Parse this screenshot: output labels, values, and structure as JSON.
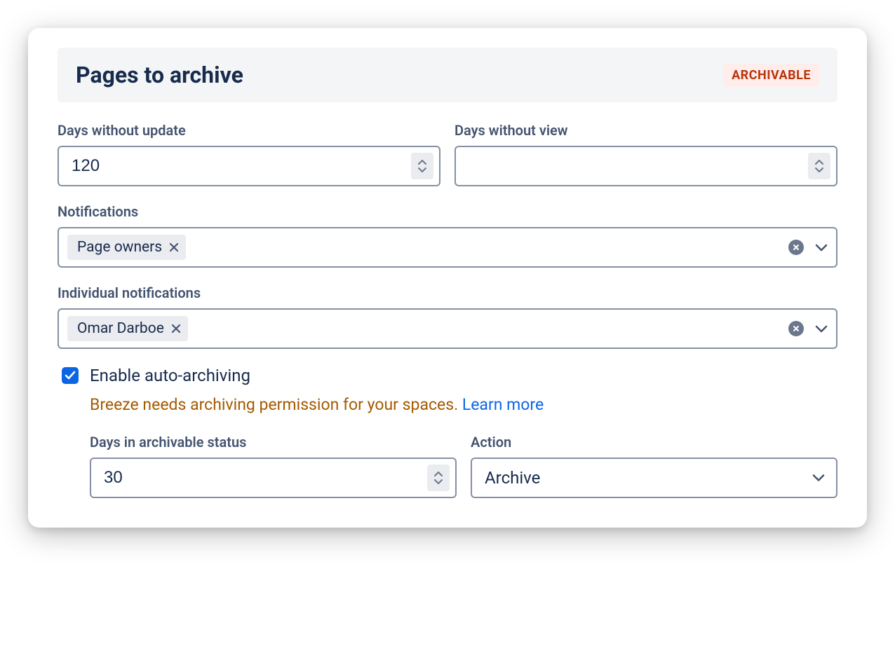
{
  "header": {
    "title": "Pages to archive",
    "badge": "ARCHIVABLE"
  },
  "fields": {
    "days_without_update": {
      "label": "Days without update",
      "value": "120"
    },
    "days_without_view": {
      "label": "Days without view",
      "value": ""
    },
    "notifications": {
      "label": "Notifications",
      "tags": [
        "Page owners"
      ]
    },
    "individual_notifications": {
      "label": "Individual notifications",
      "tags": [
        "Omar Darboe"
      ]
    }
  },
  "auto_archiving": {
    "checkbox_label": "Enable auto-archiving",
    "checked": true,
    "warning": "Breeze needs archiving permission for your spaces. ",
    "learn_more": "Learn more",
    "days_in_status": {
      "label": "Days in archivable status",
      "value": "30"
    },
    "action": {
      "label": "Action",
      "value": "Archive"
    }
  }
}
